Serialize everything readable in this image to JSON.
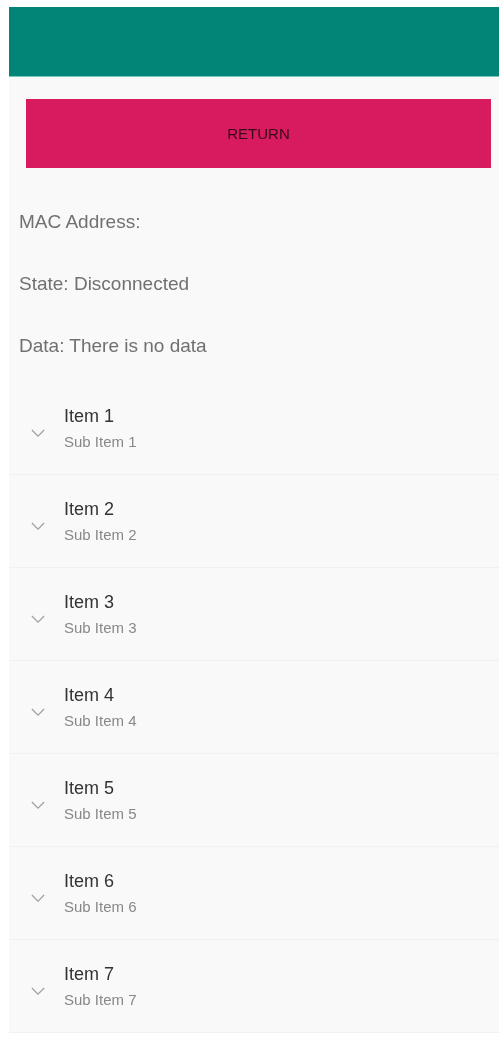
{
  "return_button": {
    "label": "RETURN"
  },
  "info": [
    "MAC Address:",
    "State: Disconnected",
    "Data: There is no data"
  ],
  "items": [
    {
      "title": "Item 1",
      "subtitle": "Sub Item 1",
      "expanded": false
    },
    {
      "title": "Item 2",
      "subtitle": "Sub Item 2",
      "expanded": false
    },
    {
      "title": "Item 3",
      "subtitle": "Sub Item 3",
      "expanded": false
    },
    {
      "title": "Item 4",
      "subtitle": "Sub Item 4",
      "expanded": false
    },
    {
      "title": "Item 5",
      "subtitle": "Sub Item 5",
      "expanded": false
    },
    {
      "title": "Item 6",
      "subtitle": "Sub Item 6",
      "expanded": false
    },
    {
      "title": "Item 7",
      "subtitle": "Sub Item 7",
      "expanded": false
    }
  ]
}
